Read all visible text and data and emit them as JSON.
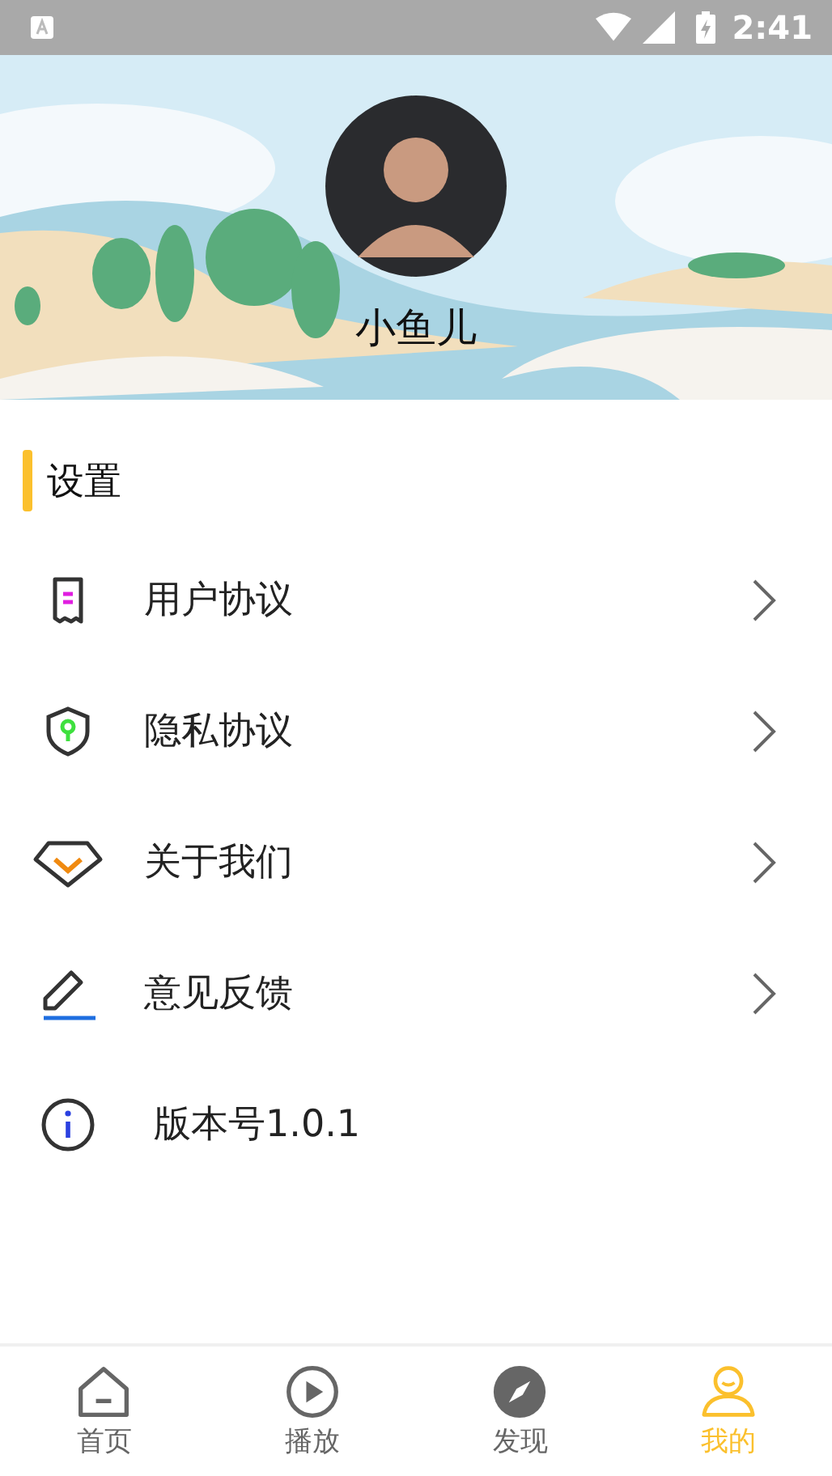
{
  "status_bar": {
    "time": "2:41"
  },
  "profile": {
    "name": "小鱼儿"
  },
  "section": {
    "title": "设置"
  },
  "menu": [
    {
      "kind": "document",
      "label": "用户协议",
      "arrow": true
    },
    {
      "kind": "shield",
      "label": "隐私协议",
      "arrow": true
    },
    {
      "kind": "diamond",
      "label": "关于我们",
      "arrow": true
    },
    {
      "kind": "pencil",
      "label": "意见反馈",
      "arrow": true
    },
    {
      "kind": "info",
      "label": "版本号1.0.1",
      "arrow": false
    }
  ],
  "tabs": [
    {
      "kind": "home",
      "label": "首页",
      "selected": false
    },
    {
      "kind": "play",
      "label": "播放",
      "selected": false
    },
    {
      "kind": "compass",
      "label": "发现",
      "selected": false
    },
    {
      "kind": "person",
      "label": "我的",
      "selected": true
    }
  ]
}
